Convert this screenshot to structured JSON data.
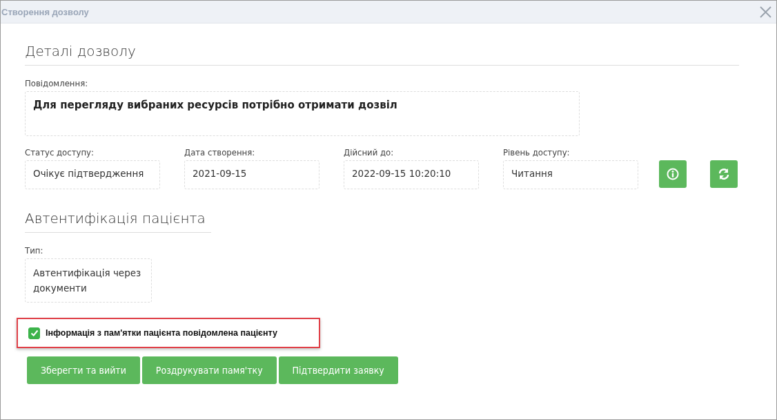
{
  "window": {
    "title": "Створення дозволу"
  },
  "details": {
    "heading": "Деталі дозволу",
    "message_label": "Повідомлення:",
    "message": "Для перегляду вибраних ресурсів потрібно отримати дозвіл",
    "fields": [
      {
        "label": "Статус доступу:",
        "value": "Очікує підтвердження"
      },
      {
        "label": "Дата створення:",
        "value": "2021-09-15"
      },
      {
        "label": "Дійсний до:",
        "value": "2022-09-15 10:20:10"
      },
      {
        "label": "Рівень доступу:",
        "value": "Читання"
      }
    ]
  },
  "auth": {
    "heading": "Автентифікація пацієнта",
    "type_label": "Тип:",
    "type_value": "Автентифікація через документи"
  },
  "confirmation": {
    "label": "Інформація з пам'ятки пацієнта повідомлена пацієнту",
    "checked": true,
    "highlighted": true
  },
  "buttons": [
    "Зберегти та вийти",
    "Роздрукувати памя'тку",
    "Підтвердити заявку"
  ]
}
